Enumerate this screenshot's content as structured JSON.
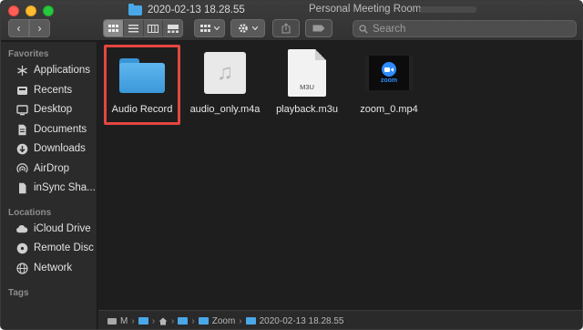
{
  "window": {
    "title": "2020-02-13 18.28.55",
    "subtitle": "Personal Meeting Room"
  },
  "toolbar": {
    "back_glyph": "‹",
    "forward_glyph": "›",
    "view_modes": [
      "icon",
      "list",
      "column",
      "gallery"
    ],
    "active_view": "icon",
    "search_placeholder": "Search"
  },
  "sidebar": {
    "favorites_label": "Favorites",
    "favorites": [
      {
        "label": "Applications",
        "icon": "applications-icon"
      },
      {
        "label": "Recents",
        "icon": "recents-icon"
      },
      {
        "label": "Desktop",
        "icon": "desktop-icon"
      },
      {
        "label": "Documents",
        "icon": "documents-icon"
      },
      {
        "label": "Downloads",
        "icon": "downloads-icon"
      },
      {
        "label": "AirDrop",
        "icon": "airdrop-icon"
      },
      {
        "label": "inSync Sha...",
        "icon": "file-icon"
      }
    ],
    "locations_label": "Locations",
    "locations": [
      {
        "label": "iCloud Drive",
        "icon": "cloud-icon"
      },
      {
        "label": "Remote Disc",
        "icon": "disc-icon"
      },
      {
        "label": "Network",
        "icon": "network-icon"
      }
    ],
    "tags_label": "Tags"
  },
  "files": [
    {
      "name": "Audio Record",
      "kind": "folder",
      "selected": true
    },
    {
      "name": "audio_only.m4a",
      "kind": "audio"
    },
    {
      "name": "playback.m3u",
      "kind": "document",
      "ext": "M3U"
    },
    {
      "name": "zoom_0.mp4",
      "kind": "video",
      "thumb_text": "zoom"
    }
  ],
  "pathbar": {
    "segments": [
      "M",
      "Zoom",
      "2020-02-13 18.28.55"
    ]
  },
  "colors": {
    "selection": "#e4463f",
    "folder": "#4aa8e8",
    "zoom_blue": "#2d8cff"
  }
}
